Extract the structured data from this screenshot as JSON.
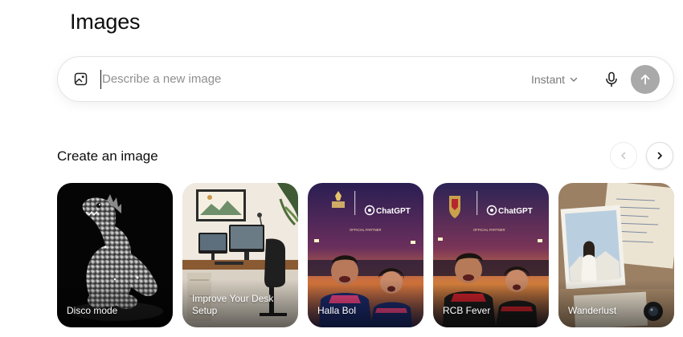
{
  "page": {
    "title": "Images"
  },
  "prompt": {
    "placeholder": "Describe a new image",
    "value": "",
    "mode": "Instant",
    "icons": {
      "attach": "image-icon",
      "mic": "mic-icon",
      "send": "arrow-up-icon",
      "mode": "chevron-down-icon"
    }
  },
  "section": {
    "title": "Create an image",
    "nav": {
      "prev": "chevron-left-icon",
      "next": "chevron-right-icon"
    }
  },
  "cards": [
    {
      "label": "Disco mode"
    },
    {
      "label": "Improve Your Desk Setup"
    },
    {
      "label": "Halla Bol",
      "partner_text": "ChatGPT",
      "official_text": "OFFICIAL PARTNER"
    },
    {
      "label": "RCB Fever",
      "partner_text": "ChatGPT",
      "official_text": "OFFICIAL PARTNER"
    },
    {
      "label": "Wanderlust"
    }
  ],
  "colors": {
    "send_disabled": "#a9a9a9",
    "placeholder": "#8f8f8f"
  }
}
